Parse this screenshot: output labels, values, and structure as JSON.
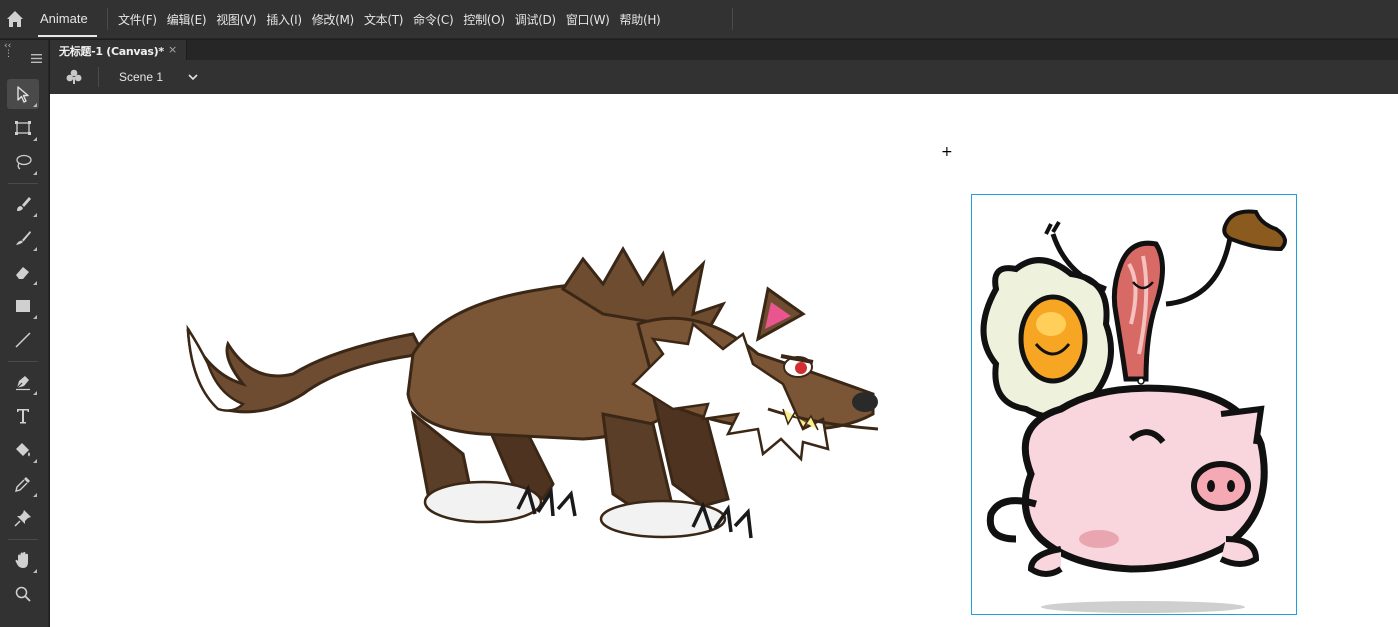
{
  "app": {
    "name": "Animate",
    "menu": [
      {
        "label": "文件(F)"
      },
      {
        "label": "编辑(E)"
      },
      {
        "label": "视图(V)"
      },
      {
        "label": "插入(I)"
      },
      {
        "label": "修改(M)"
      },
      {
        "label": "文本(T)"
      },
      {
        "label": "命令(C)"
      },
      {
        "label": "控制(O)"
      },
      {
        "label": "调试(D)"
      },
      {
        "label": "窗口(W)"
      },
      {
        "label": "帮助(H)"
      }
    ]
  },
  "document": {
    "tab_label": "无标题-1 (Canvas)*",
    "close_glyph": "×"
  },
  "scene": {
    "label": "Scene 1"
  },
  "tools": [
    "selection-tool",
    "free-transform-tool",
    "lasso-tool",
    "paint-brush-tool",
    "brush-tool",
    "eraser-tool",
    "rectangle-tool",
    "line-tool",
    "pen-tool",
    "text-tool",
    "paint-bucket-tool",
    "eyedropper-tool",
    "pin-tool",
    "hand-tool",
    "zoom-tool"
  ],
  "stage": {
    "crosshair_glyph": "+",
    "selection_color": "#1fa0d8",
    "background": "#ffffff"
  },
  "colors": {
    "chrome": "#323232",
    "tab_bar": "#262626",
    "text": "#e6e6e6"
  }
}
